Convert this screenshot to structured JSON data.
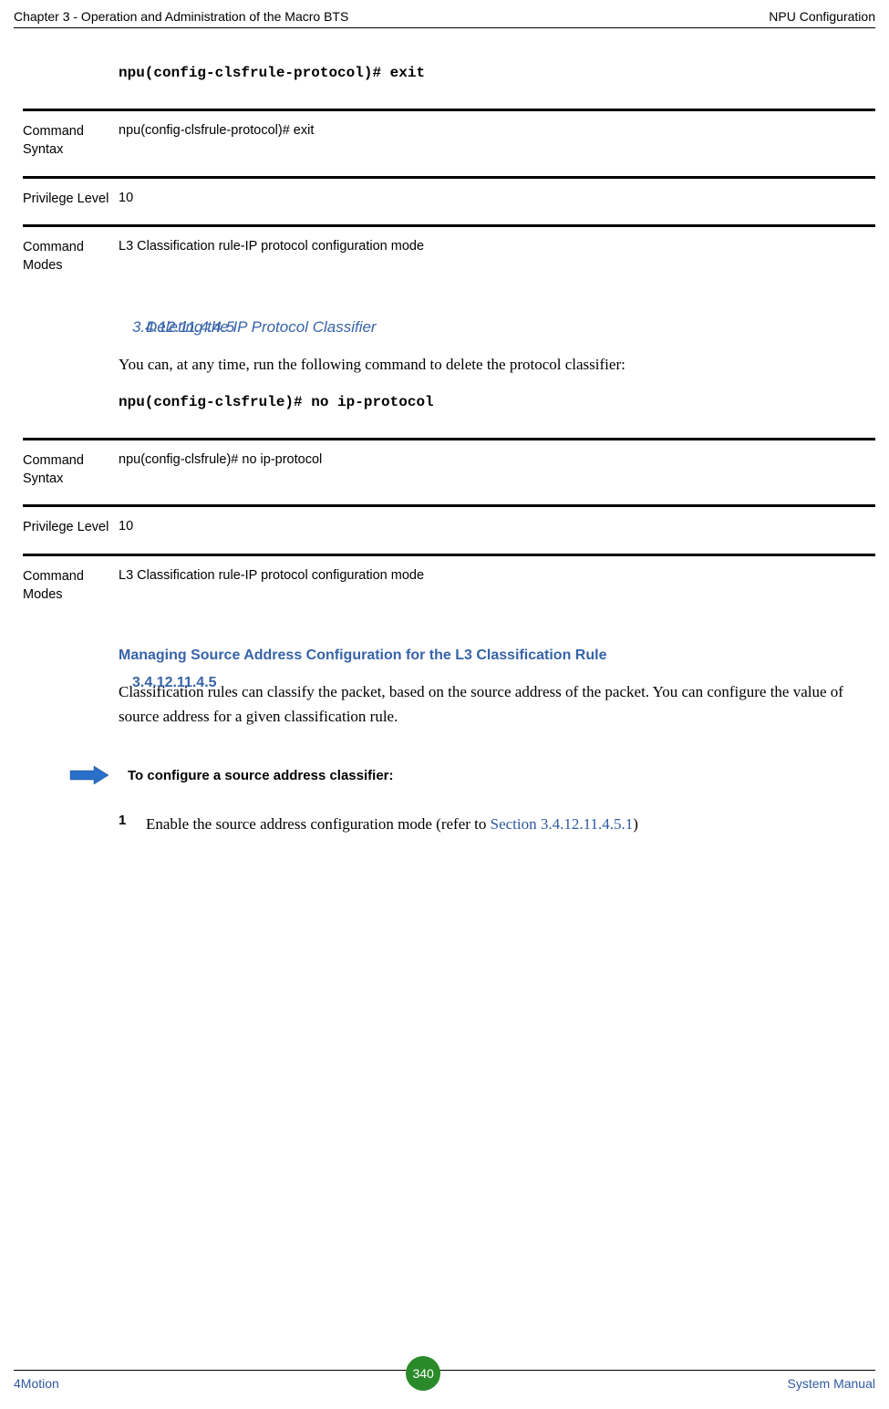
{
  "header": {
    "left": "Chapter 3 - Operation and Administration of the Macro BTS",
    "right": "NPU Configuration"
  },
  "cmd1": "npu(config-clsfrule-protocol)# exit",
  "block1": {
    "syntax_label": "Command Syntax",
    "syntax_value": "npu(config-clsfrule-protocol)# exit",
    "priv_label": "Privilege Level",
    "priv_value": "10",
    "modes_label": "Command Modes",
    "modes_value": "L3 Classification rule-IP protocol configuration mode"
  },
  "sec_sub": {
    "num": "3.4.12.11.4.4.5",
    "title": "Deleting the IP Protocol Classifier",
    "body": " You can, at any time, run the following command to delete the protocol classifier:",
    "cmd": "npu(config-clsfrule)# no ip-protocol"
  },
  "block2": {
    "syntax_label": "Command Syntax",
    "syntax_value": "npu(config-clsfrule)# no ip-protocol",
    "priv_label": "Privilege Level",
    "priv_value": "10",
    "modes_label": "Command Modes",
    "modes_value": "L3 Classification rule-IP protocol configuration mode"
  },
  "sec_main": {
    "num": "3.4.12.11.4.5",
    "title": "Managing Source Address Configuration for the L3 Classification Rule",
    "body": "Classification rules can classify the packet, based on the source address of the packet. You can configure the value of source address for a given classification rule."
  },
  "arrow_text": "To configure a source address classifier:",
  "step1": {
    "num": "1",
    "text": "Enable the source address configuration mode (refer to ",
    "link": "Section 3.4.12.11.4.5.1",
    "tail": ")"
  },
  "footer": {
    "left": "4Motion",
    "page": "340",
    "right": "System Manual"
  }
}
